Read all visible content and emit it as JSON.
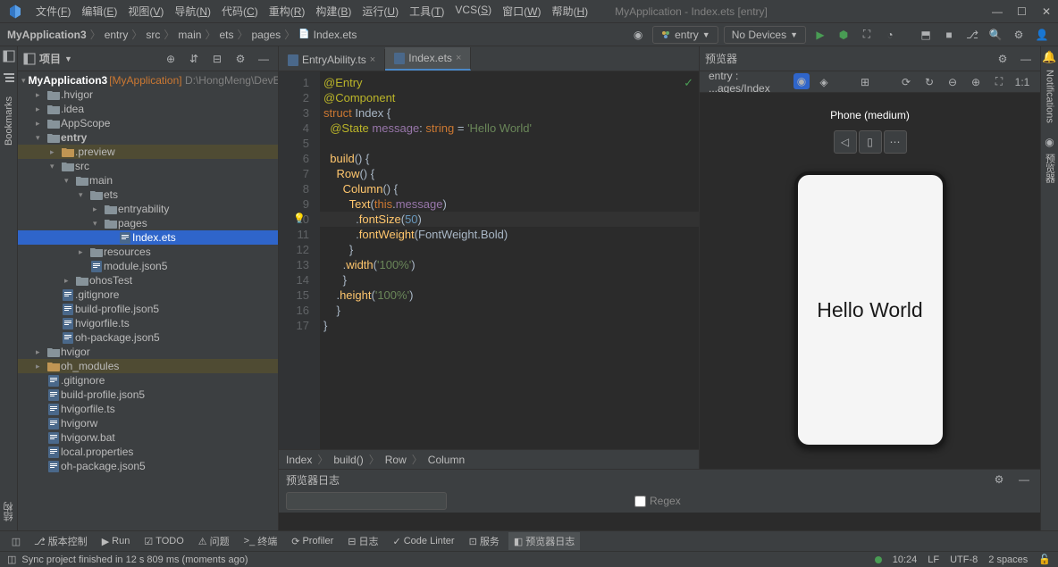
{
  "window": {
    "title": "MyApplication - Index.ets [entry]"
  },
  "menus": [
    "文件(F)",
    "编辑(E)",
    "视图(V)",
    "导航(N)",
    "代码(C)",
    "重构(R)",
    "构建(B)",
    "运行(U)",
    "工具(T)",
    "VCS(S)",
    "窗口(W)",
    "帮助(H)"
  ],
  "breadcrumb": [
    "MyApplication3",
    "entry",
    "src",
    "main",
    "ets",
    "pages",
    "Index.ets"
  ],
  "run_config": {
    "module": "entry",
    "device": "No Devices"
  },
  "project": {
    "panel_title": "项目",
    "root": {
      "name": "MyApplication3",
      "suffix": "[MyApplication]",
      "path": "D:\\HongMeng\\DevEcoS"
    },
    "tree": [
      {
        "l": 1,
        "a": "▸",
        "i": "folder",
        "t": ".hvigor"
      },
      {
        "l": 1,
        "a": "▸",
        "i": "folder",
        "t": ".idea"
      },
      {
        "l": 1,
        "a": "▸",
        "i": "folder",
        "t": "AppScope"
      },
      {
        "l": 1,
        "a": "▾",
        "i": "folder",
        "t": "entry",
        "bold": true
      },
      {
        "l": 2,
        "a": "▸",
        "i": "folder-o",
        "t": ".preview",
        "hl": true
      },
      {
        "l": 2,
        "a": "▾",
        "i": "folder",
        "t": "src"
      },
      {
        "l": 3,
        "a": "▾",
        "i": "folder",
        "t": "main"
      },
      {
        "l": 4,
        "a": "▾",
        "i": "folder",
        "t": "ets"
      },
      {
        "l": 5,
        "a": "▸",
        "i": "folder",
        "t": "entryability"
      },
      {
        "l": 5,
        "a": "▾",
        "i": "folder",
        "t": "pages"
      },
      {
        "l": 6,
        "a": "",
        "i": "file",
        "t": "Index.ets",
        "sel": true
      },
      {
        "l": 4,
        "a": "▸",
        "i": "folder",
        "t": "resources"
      },
      {
        "l": 4,
        "a": "",
        "i": "file",
        "t": "module.json5"
      },
      {
        "l": 3,
        "a": "▸",
        "i": "folder",
        "t": "ohosTest"
      },
      {
        "l": 2,
        "a": "",
        "i": "file",
        "t": ".gitignore"
      },
      {
        "l": 2,
        "a": "",
        "i": "file",
        "t": "build-profile.json5"
      },
      {
        "l": 2,
        "a": "",
        "i": "file",
        "t": "hvigorfile.ts"
      },
      {
        "l": 2,
        "a": "",
        "i": "file",
        "t": "oh-package.json5"
      },
      {
        "l": 1,
        "a": "▸",
        "i": "folder",
        "t": "hvigor"
      },
      {
        "l": 1,
        "a": "▸",
        "i": "folder-o",
        "t": "oh_modules",
        "hl": true
      },
      {
        "l": 1,
        "a": "",
        "i": "file",
        "t": ".gitignore"
      },
      {
        "l": 1,
        "a": "",
        "i": "file",
        "t": "build-profile.json5"
      },
      {
        "l": 1,
        "a": "",
        "i": "file",
        "t": "hvigorfile.ts"
      },
      {
        "l": 1,
        "a": "",
        "i": "file",
        "t": "hvigorw"
      },
      {
        "l": 1,
        "a": "",
        "i": "file",
        "t": "hvigorw.bat"
      },
      {
        "l": 1,
        "a": "",
        "i": "file",
        "t": "local.properties"
      },
      {
        "l": 1,
        "a": "",
        "i": "file",
        "t": "oh-package.json5"
      }
    ]
  },
  "editor": {
    "tabs": [
      {
        "name": "EntryAbility.ts",
        "active": false
      },
      {
        "name": "Index.ets",
        "active": true
      }
    ],
    "lines": [
      {
        "n": 1,
        "html": "<span class='dec'>@Entry</span>"
      },
      {
        "n": 2,
        "html": "<span class='dec'>@Component</span>"
      },
      {
        "n": 3,
        "html": "<span class='kw'>struct</span> <span class='id'>Index</span> <span class='p'>{</span>"
      },
      {
        "n": 4,
        "html": "  <span class='dec'>@State</span> <span class='prop'>message</span><span class='p'>:</span> <span class='type'>string</span> <span class='p'>=</span> <span class='str'>'Hello World'</span>"
      },
      {
        "n": 5,
        "html": ""
      },
      {
        "n": 6,
        "html": "  <span class='fn'>build</span><span class='p'>() {</span>"
      },
      {
        "n": 7,
        "html": "    <span class='fn'>Row</span><span class='p'>() {</span>"
      },
      {
        "n": 8,
        "html": "      <span class='fn'>Column</span><span class='p'>() {</span>"
      },
      {
        "n": 9,
        "html": "        <span class='fn'>Text</span><span class='p'>(</span><span class='kw'>this</span><span class='p'>.</span><span class='prop'>message</span><span class='p'>)</span>"
      },
      {
        "n": 10,
        "html": "          <span class='p'>.</span><span class='fn'>fontSize</span><span class='p'>(</span><span class='num'>50</span><span class='p'>)</span>",
        "cursor": true,
        "bulb": true
      },
      {
        "n": 11,
        "html": "          <span class='p'>.</span><span class='fn'>fontWeight</span><span class='p'>(</span><span class='id'>FontWeight</span><span class='p'>.</span><span class='id'>Bold</span><span class='p'>)</span>"
      },
      {
        "n": 12,
        "html": "        <span class='p'>}</span>"
      },
      {
        "n": 13,
        "html": "      <span class='p'>.</span><span class='fn'>width</span><span class='p'>(</span><span class='str'>'100%'</span><span class='p'>)</span>"
      },
      {
        "n": 14,
        "html": "      <span class='p'>}</span>"
      },
      {
        "n": 15,
        "html": "    <span class='p'>.</span><span class='fn'>height</span><span class='p'>(</span><span class='str'>'100%'</span><span class='p'>)</span>"
      },
      {
        "n": 16,
        "html": "    <span class='p'>}</span>"
      },
      {
        "n": 17,
        "html": "<span class='p'>}</span>"
      }
    ],
    "breadcrumb": [
      "Index",
      "build()",
      "Row",
      "Column"
    ]
  },
  "previewer": {
    "panel_title": "预览器",
    "route": "entry : ...ages/Index",
    "device_label": "Phone (medium)",
    "content": "Hello World"
  },
  "log": {
    "panel_title": "预览器日志",
    "regex_label": "Regex"
  },
  "bottom_tabs": [
    {
      "i": "⎇",
      "t": "版本控制"
    },
    {
      "i": "▶",
      "t": "Run"
    },
    {
      "i": "☑",
      "t": "TODO"
    },
    {
      "i": "⚠",
      "t": "问题"
    },
    {
      "i": ">_",
      "t": "终端"
    },
    {
      "i": "⟳",
      "t": "Profiler"
    },
    {
      "i": "⊟",
      "t": "日志"
    },
    {
      "i": "✓",
      "t": "Code Linter"
    },
    {
      "i": "⊡",
      "t": "服务"
    },
    {
      "i": "◧",
      "t": "预览器日志",
      "active": true
    }
  ],
  "status": {
    "message": "Sync project finished in 12 s 809 ms (moments ago)",
    "cursor": "10:24",
    "line_sep": "LF",
    "encoding": "UTF-8",
    "indent": "2 spaces"
  },
  "icons": {
    "file": "📄"
  }
}
